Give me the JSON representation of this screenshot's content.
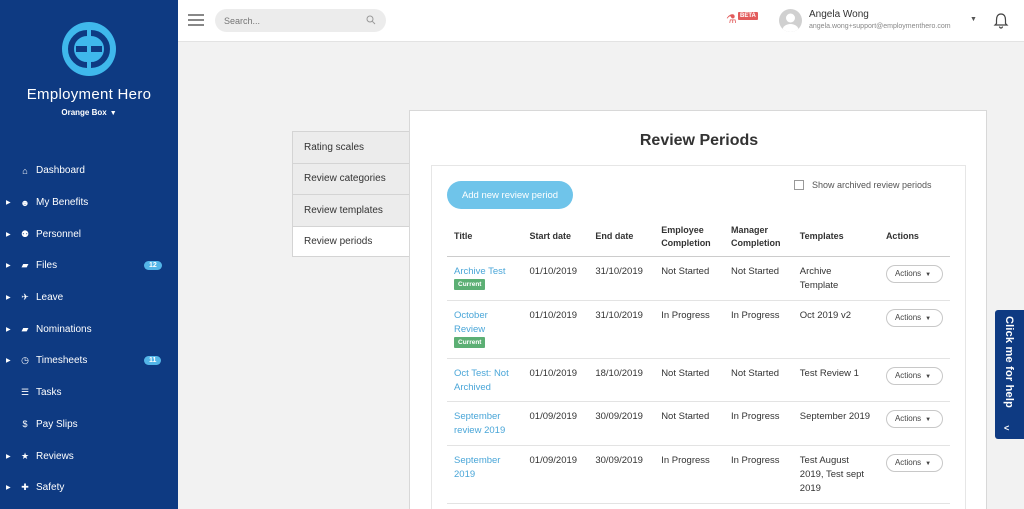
{
  "brand": {
    "name": "Employment Hero",
    "org": "Orange Box"
  },
  "nav": [
    {
      "label": "Dashboard",
      "icon": "home-icon",
      "glyph": "⌂",
      "arrow": false,
      "badge": ""
    },
    {
      "label": "My Benefits",
      "icon": "smile-icon",
      "glyph": "☻",
      "arrow": true,
      "badge": ""
    },
    {
      "label": "Personnel",
      "icon": "people-icon",
      "glyph": "⚉",
      "arrow": true,
      "badge": ""
    },
    {
      "label": "Files",
      "icon": "folder-icon",
      "glyph": "▰",
      "arrow": true,
      "badge": "12"
    },
    {
      "label": "Leave",
      "icon": "plane-icon",
      "glyph": "✈",
      "arrow": true,
      "badge": ""
    },
    {
      "label": "Nominations",
      "icon": "folder-icon",
      "glyph": "▰",
      "arrow": true,
      "badge": ""
    },
    {
      "label": "Timesheets",
      "icon": "clock-icon",
      "glyph": "◷",
      "arrow": true,
      "badge": "11"
    },
    {
      "label": "Tasks",
      "icon": "list-icon",
      "glyph": "☰",
      "arrow": false,
      "badge": ""
    },
    {
      "label": "Pay Slips",
      "icon": "dollar-icon",
      "glyph": "$",
      "arrow": false,
      "badge": ""
    },
    {
      "label": "Reviews",
      "icon": "star-icon",
      "glyph": "★",
      "arrow": true,
      "badge": ""
    },
    {
      "label": "Safety",
      "icon": "medkit-icon",
      "glyph": "✚",
      "arrow": true,
      "badge": ""
    }
  ],
  "topbar": {
    "search_placeholder": "Search...",
    "beta_label": "BETA",
    "user_name": "Angela Wong",
    "user_email": "angela.wong+support@employmenthero.com"
  },
  "tabs": [
    {
      "label": "Rating scales",
      "active": false
    },
    {
      "label": "Review categories",
      "active": false
    },
    {
      "label": "Review templates",
      "active": false
    },
    {
      "label": "Review periods",
      "active": true
    }
  ],
  "main": {
    "title": "Review Periods",
    "add_button": "Add new review period",
    "show_archived_label": "Show archived review periods",
    "columns": [
      "Title",
      "Start date",
      "End date",
      "Employee Completion",
      "Manager Completion",
      "Templates",
      "Actions"
    ],
    "rows": [
      {
        "title": "Archive Test",
        "current": true,
        "start": "01/10/2019",
        "end": "31/10/2019",
        "employee": "Not Started",
        "manager": "Not Started",
        "templates": "Archive Template"
      },
      {
        "title": "October Review",
        "current": true,
        "start": "01/10/2019",
        "end": "31/10/2019",
        "employee": "In Progress",
        "manager": "In Progress",
        "templates": "Oct 2019 v2"
      },
      {
        "title": "Oct Test: Not Archived",
        "current": false,
        "start": "01/10/2019",
        "end": "18/10/2019",
        "employee": "Not Started",
        "manager": "Not Started",
        "templates": "Test Review 1"
      },
      {
        "title": "September review 2019",
        "current": false,
        "start": "01/09/2019",
        "end": "30/09/2019",
        "employee": "Not Started",
        "manager": "In Progress",
        "templates": "September 2019"
      },
      {
        "title": "September 2019",
        "current": false,
        "start": "01/09/2019",
        "end": "30/09/2019",
        "employee": "In Progress",
        "manager": "In Progress",
        "templates": "Test August 2019, Test sept 2019"
      }
    ],
    "current_badge": "Current",
    "actions_label": "Actions"
  },
  "help": {
    "label": "Click me for help"
  },
  "colors": {
    "sidebar": "#0e3a82",
    "accent": "#6fc4ea",
    "link": "#4aa6d8",
    "current_badge": "#5caf74",
    "beta": "#e25b5b"
  }
}
